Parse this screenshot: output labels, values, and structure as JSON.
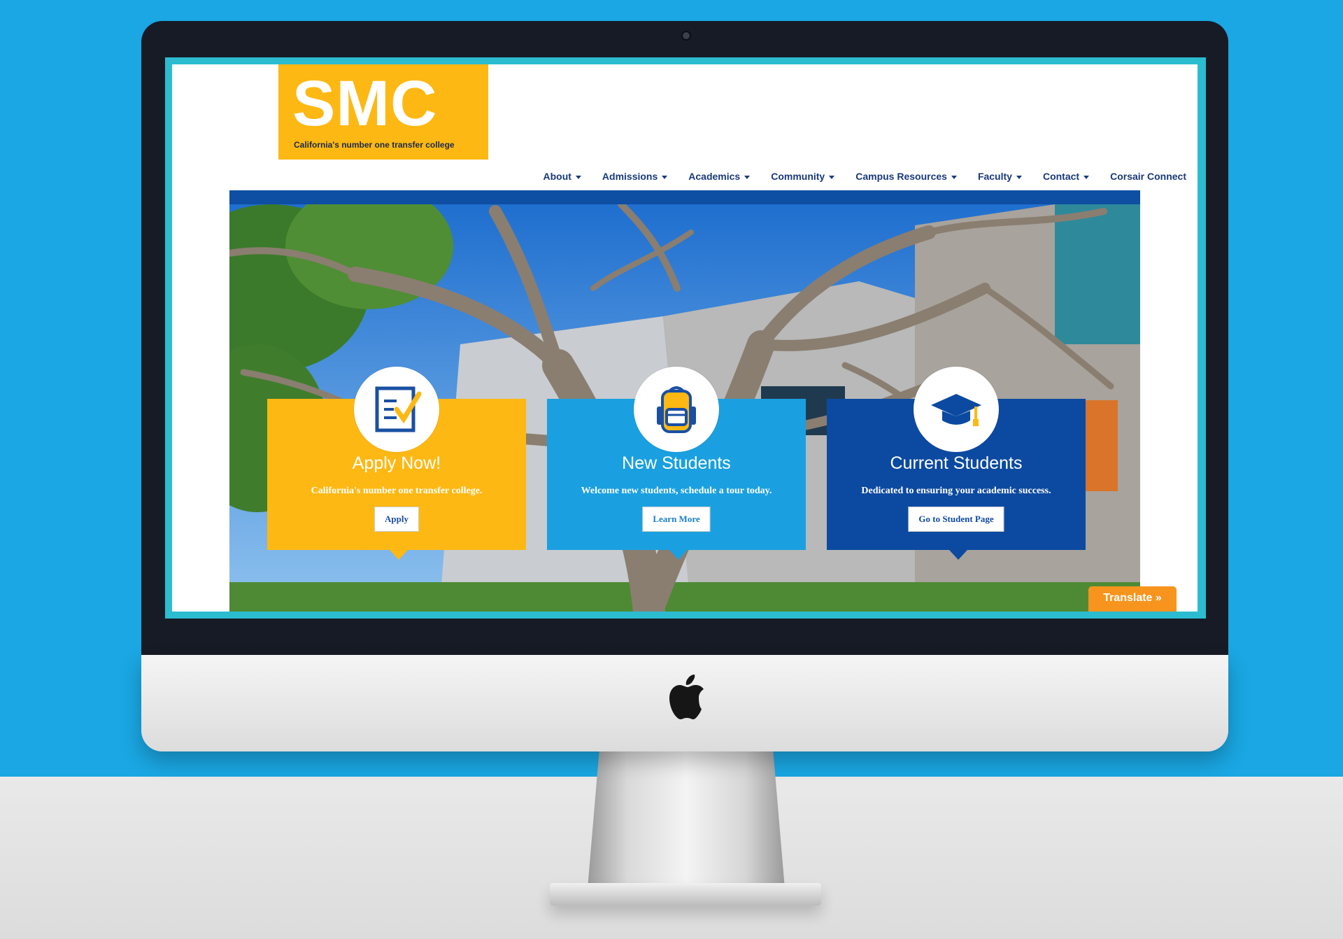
{
  "site": {
    "logo_text": "SMC",
    "tagline": "California's number one transfer college"
  },
  "nav": [
    {
      "label": "About"
    },
    {
      "label": "Admissions"
    },
    {
      "label": "Academics"
    },
    {
      "label": "Community"
    },
    {
      "label": "Campus Resources"
    },
    {
      "label": "Faculty"
    },
    {
      "label": "Contact"
    },
    {
      "label": "Corsair Connect"
    }
  ],
  "cards": [
    {
      "title": "Apply Now!",
      "description": "California's number one transfer college.",
      "button": "Apply",
      "icon": "application-checklist-icon",
      "color": "#fdb813"
    },
    {
      "title": "New Students",
      "description": "Welcome new students, schedule a tour today.",
      "button": "Learn More",
      "icon": "backpack-icon",
      "color": "#1aa0e0"
    },
    {
      "title": "Current Students",
      "description": "Dedicated to ensuring your academic success.",
      "button": "Go to Student Page",
      "icon": "graduation-cap-icon",
      "color": "#0c4aa1"
    }
  ],
  "translate_label": "Translate »",
  "colors": {
    "wall": "#1aa7e3",
    "brand_yellow": "#fdb813",
    "brand_blue": "#0e4ea3",
    "nav_text": "#1a3a7a"
  }
}
